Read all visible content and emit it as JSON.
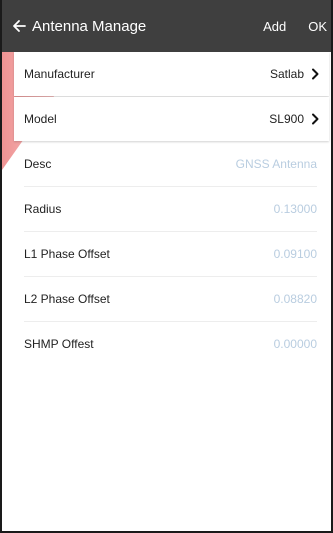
{
  "header": {
    "title": "Antenna Manage",
    "add_label": "Add",
    "ok_label": "OK",
    "back_icon": "arrow-left-icon"
  },
  "rows": [
    {
      "label": "Manufacturer",
      "value": "Satlab",
      "navigable": true
    },
    {
      "label": "Model",
      "value": "SL900",
      "navigable": true
    },
    {
      "label": "Desc",
      "value": "GNSS Antenna",
      "navigable": false
    },
    {
      "label": "Radius",
      "value": "0.13000",
      "navigable": false
    },
    {
      "label": "L1 Phase Offset",
      "value": "0.09100",
      "navigable": false
    },
    {
      "label": "L2 Phase Offset",
      "value": "0.08820",
      "navigable": false
    },
    {
      "label": "SHMP Offest",
      "value": "0.00000",
      "navigable": false
    }
  ],
  "colors": {
    "topbar": "#3f3f3f",
    "muted_value": "#b9cde0",
    "text": "#222222",
    "divider": "#ededed"
  }
}
